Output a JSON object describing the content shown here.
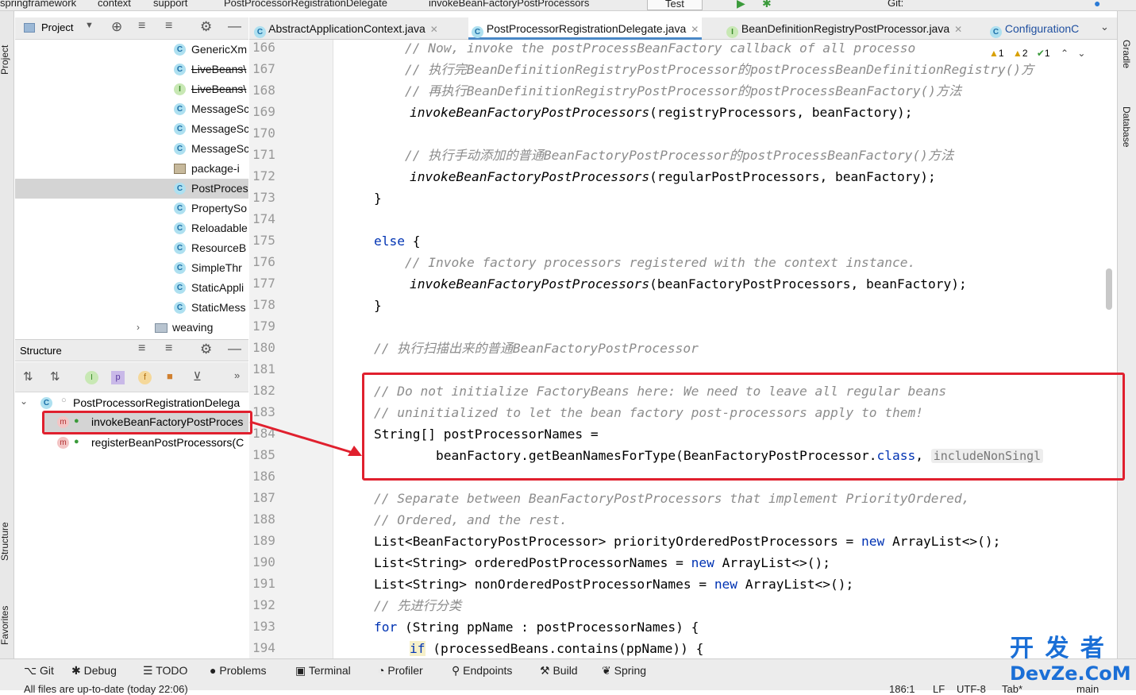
{
  "breadcrumbs": [
    "springframework",
    "context",
    "support",
    "PostProcessorRegistrationDelegate",
    "invokeBeanFactoryPostProcessors"
  ],
  "run_config": "Test",
  "git_label": "Git:",
  "left_strip": {
    "project": "Project",
    "structure": "Structure",
    "favorites": "Favorites"
  },
  "right_strip": {
    "gradle": "Gradle",
    "database": "Database"
  },
  "project_panel": {
    "title": "Project",
    "items": [
      {
        "label": "GenericXm",
        "icon": "C",
        "strike": false
      },
      {
        "label": "LiveBeans\\",
        "icon": "C",
        "strike": true
      },
      {
        "label": "LiveBeans\\",
        "icon": "I",
        "strike": true
      },
      {
        "label": "MessageSc",
        "icon": "C",
        "strike": false
      },
      {
        "label": "MessageSc",
        "icon": "C",
        "strike": false
      },
      {
        "label": "MessageSc",
        "icon": "C",
        "strike": false
      },
      {
        "label": "package-i",
        "icon": "pkg",
        "strike": false
      },
      {
        "label": "PostProces",
        "icon": "C",
        "strike": false,
        "selected": true
      },
      {
        "label": "PropertySo",
        "icon": "C",
        "strike": false
      },
      {
        "label": "Reloadable",
        "icon": "C",
        "strike": false
      },
      {
        "label": "ResourceB",
        "icon": "C",
        "strike": false
      },
      {
        "label": "SimpleThr",
        "icon": "C",
        "strike": false
      },
      {
        "label": "StaticAppli",
        "icon": "C",
        "strike": false
      },
      {
        "label": "StaticMess",
        "icon": "C",
        "strike": false
      },
      {
        "label": "weaving",
        "icon": "folder",
        "strike": false
      }
    ]
  },
  "structure_panel": {
    "title": "Structure",
    "root": "PostProcessorRegistrationDelega",
    "methods": [
      "invokeBeanFactoryPostProces",
      "registerBeanPostProcessors(C"
    ]
  },
  "tabs": [
    {
      "label": "AbstractApplicationContext.java",
      "icon": "C",
      "active": false
    },
    {
      "label": "PostProcessorRegistrationDelegate.java",
      "icon": "C",
      "active": true
    },
    {
      "label": "BeanDefinitionRegistryPostProcessor.java",
      "icon": "I",
      "active": false
    },
    {
      "label": "ConfigurationC",
      "icon": "C",
      "active": false
    }
  ],
  "inspections": {
    "warn1": "1",
    "warn2": "2",
    "ok": "1"
  },
  "line_numbers": [
    "166",
    "167",
    "168",
    "169",
    "170",
    "171",
    "172",
    "173",
    "174",
    "175",
    "176",
    "177",
    "178",
    "179",
    "180",
    "181",
    "182",
    "183",
    "184",
    "185",
    "186",
    "187",
    "188",
    "189",
    "190",
    "191",
    "192",
    "193",
    "194"
  ],
  "code": {
    "l166": "    // Now, invoke the postProcessBeanFactory callback of all processo",
    "l167": "    // 执行完BeanDefinitionRegistryPostProcessor的postProcessBeanDefinitionRegistry()方",
    "l168": "    // 再执行BeanDefinitionRegistryPostProcessor的postProcessBeanFactory()方法",
    "l169_fn": "invokeBeanFactoryPostProcessors",
    "l169_rest": "(registryProcessors, beanFactory);",
    "l171": "    // 执行手动添加的普通BeanFactoryPostProcessor的postProcessBeanFactory()方法",
    "l172_fn": "invokeBeanFactoryPostProcessors",
    "l172_rest": "(regularPostProcessors, beanFactory);",
    "l173": "}",
    "l175_kw": "else",
    "l175_rest": " {",
    "l176": "    // Invoke factory processors registered with the context instance.",
    "l177_fn": "invokeBeanFactoryPostProcessors",
    "l177_rest": "(beanFactoryPostProcessors, beanFactory);",
    "l178": "}",
    "l180": "// 执行扫描出来的普通BeanFactoryPostProcessor",
    "l182": "// Do not initialize FactoryBeans here: We need to leave all regular beans",
    "l183": "// uninitialized to let the bean factory post-processors apply to them!",
    "l184": "String[] postProcessorNames =",
    "l185_a": "        beanFactory.getBeanNamesForType(BeanFactoryPostProcessor.",
    "l185_kw": "class",
    "l185_b": ", ",
    "l185_hint": "includeNonSingl",
    "l187": "// Separate between BeanFactoryPostProcessors that implement PriorityOrdered,",
    "l188": "// Ordered, and the rest.",
    "l189_a": "List<BeanFactoryPostProcessor> priorityOrderedPostProcessors = ",
    "l189_kw": "new",
    "l189_b": " ArrayList<>();",
    "l190_a": "List<String> orderedPostProcessorNames = ",
    "l190_kw": "new",
    "l190_b": " ArrayList<>();",
    "l191_a": "List<String> nonOrderedPostProcessorNames = ",
    "l191_kw": "new",
    "l191_b": " ArrayList<>();",
    "l192": "// 先进行分类",
    "l193_kw": "for",
    "l193_rest": " (String ppName : postProcessorNames) {",
    "l194_kw": "if",
    "l194_rest": " (processedBeans.contains(ppName)) {"
  },
  "status_tools": [
    "Git",
    "Debug",
    "TODO",
    "Problems",
    "Terminal",
    "Profiler",
    "Endpoints",
    "Build",
    "Spring"
  ],
  "status_line": {
    "message": "All files are up-to-date (today 22:06)",
    "pos": "186:1",
    "lf": "LF",
    "enc": "UTF-8",
    "tab": "Tab*",
    "branch": "main"
  },
  "watermark": {
    "top": "开 发 者",
    "bottom": "DevZe.CoM"
  },
  "colors": {
    "red_highlight": "#e0202e",
    "keyword": "#0033b3",
    "comment": "#8c8c8c",
    "watermark": "#1b6fd6"
  }
}
